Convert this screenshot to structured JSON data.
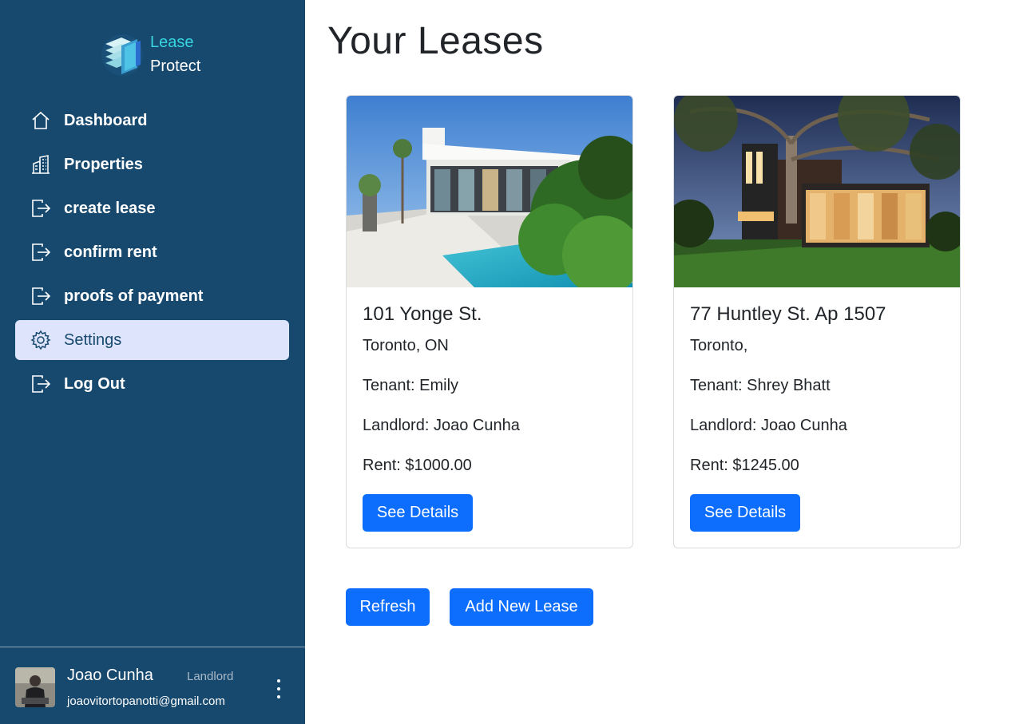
{
  "app": {
    "logo_line1": "Lease",
    "logo_line2": "Protect"
  },
  "sidebar": {
    "items": [
      {
        "label": "Dashboard",
        "icon": "home-icon"
      },
      {
        "label": "Properties",
        "icon": "buildings-icon"
      },
      {
        "label": "create lease",
        "icon": "box-arrow-right-icon"
      },
      {
        "label": "confirm rent",
        "icon": "box-arrow-right-icon"
      },
      {
        "label": "proofs of payment",
        "icon": "box-arrow-right-icon"
      },
      {
        "label": "Settings",
        "icon": "gear-icon",
        "active": true
      },
      {
        "label": "Log Out",
        "icon": "box-arrow-right-icon"
      }
    ]
  },
  "user": {
    "name": "Joao Cunha",
    "role": "Landlord",
    "email": "joaovitortopanotti@gmail.com"
  },
  "main": {
    "title": "Your Leases",
    "leases": [
      {
        "address": "101 Yonge St.",
        "city": "Toronto, ON",
        "tenant": "Tenant: Emily",
        "landlord": "Landlord: Joao Cunha",
        "rent": "Rent: $1000.00",
        "button": "See Details"
      },
      {
        "address": "77 Huntley St. Ap 1507",
        "city": "Toronto,",
        "tenant": "Tenant: Shrey Bhatt",
        "landlord": "Landlord: Joao Cunha",
        "rent": "Rent: $1245.00",
        "button": "See Details"
      }
    ],
    "refresh_label": "Refresh",
    "add_label": "Add New Lease"
  },
  "colors": {
    "sidebar_bg": "#17496f",
    "accent": "#0d6efd",
    "active_bg": "#dde4fb",
    "logo_accent": "#37d6e0"
  }
}
